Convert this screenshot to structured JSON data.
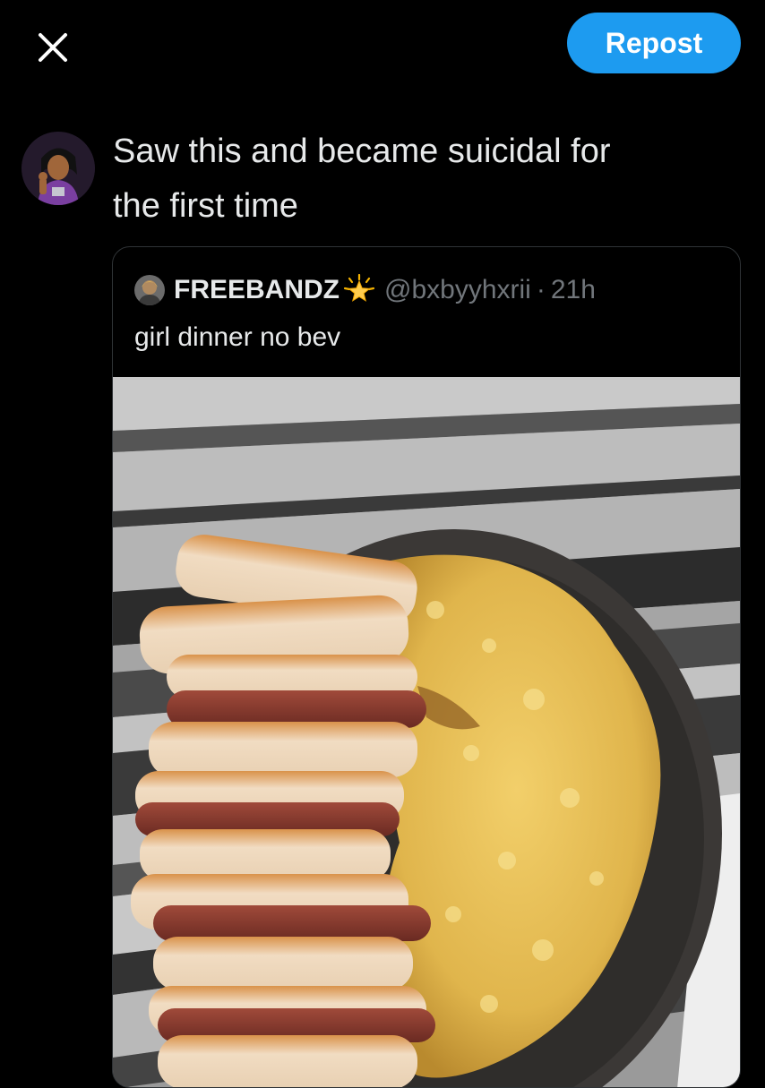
{
  "header": {
    "close_icon": "close-icon",
    "repost_label": "Repost",
    "accent_color": "#1d9bf0"
  },
  "compose": {
    "avatar_icon": "user-avatar",
    "text": "Saw this and became suicidal for\nthe first time"
  },
  "quote": {
    "display_name": "FREEBANDZ",
    "badge_icon": "sparkle-star-emoji",
    "handle": "@bxbyyhxrii",
    "separator": "·",
    "time": "21h",
    "text": "girl dinner no bev",
    "media_icon": "food-photo"
  }
}
